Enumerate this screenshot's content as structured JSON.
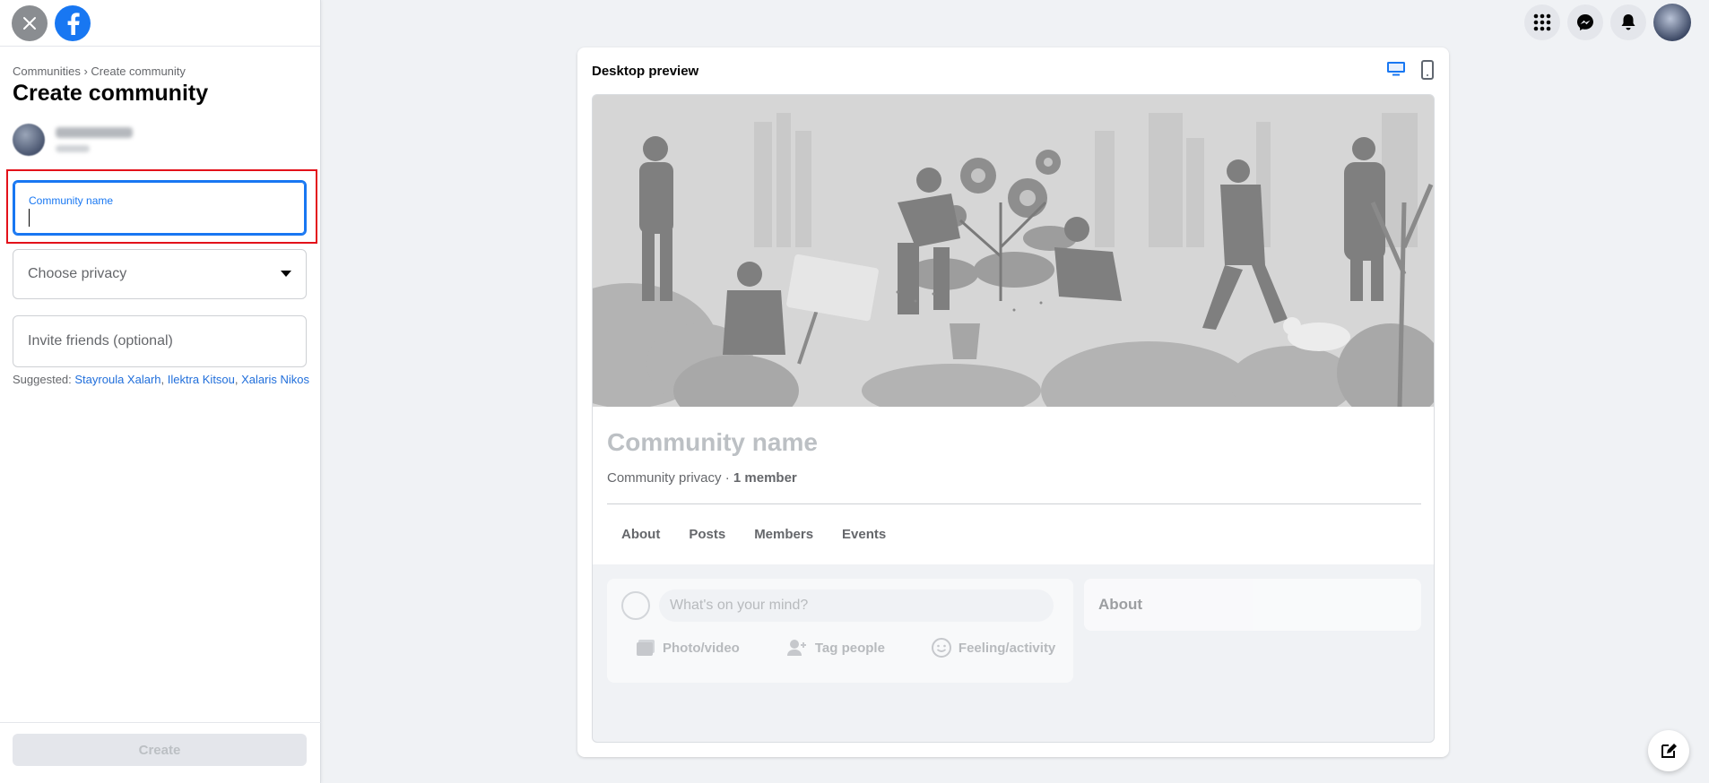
{
  "sidebar": {
    "breadcrumb": {
      "parent": "Communities",
      "separator": " › ",
      "current": "Create community"
    },
    "title": "Create community",
    "name_field": {
      "label": "Community name",
      "value": ""
    },
    "privacy_field": {
      "placeholder": "Choose privacy"
    },
    "invite_field": {
      "placeholder": "Invite friends (optional)"
    },
    "suggested": {
      "label": "Suggested: ",
      "names": [
        "Stayroula Xalarh",
        "Ilektra Kitsou",
        "Xalaris Nikos"
      ]
    },
    "create_label": "Create"
  },
  "preview": {
    "title": "Desktop preview",
    "community_name": "Community name",
    "privacy": "Community privacy",
    "member_count": "1 member",
    "tabs": [
      "About",
      "Posts",
      "Members",
      "Events"
    ],
    "composer_placeholder": "What's on your mind?",
    "actions": [
      "Photo/video",
      "Tag people",
      "Feeling/activity"
    ],
    "about_title": "About"
  },
  "icons": [
    "close-icon",
    "facebook-logo",
    "menu-grid-icon",
    "messenger-icon",
    "bell-icon",
    "desktop-icon",
    "mobile-icon",
    "edit-icon"
  ],
  "colors": {
    "accent": "#1877f2",
    "highlight": "#e3111a",
    "link": "#216fdb"
  }
}
